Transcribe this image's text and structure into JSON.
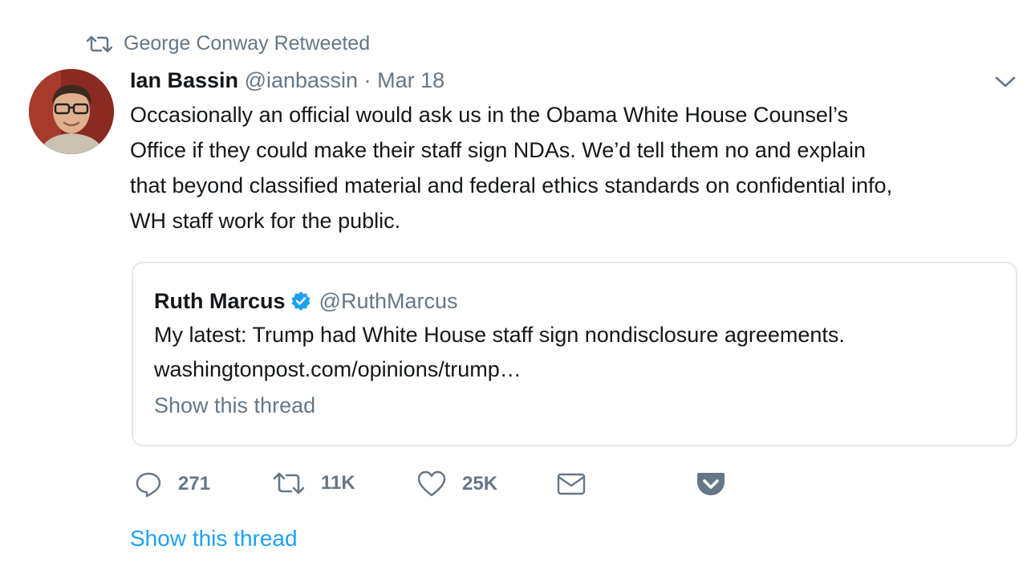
{
  "retweet_context": {
    "text": "George Conway Retweeted"
  },
  "tweet": {
    "author_name": "Ian Bassin",
    "author_handle": "@ianbassin",
    "separator": "·",
    "date": "Mar 18",
    "text_lines": [
      "Occasionally an official would ask us in the Obama White House Counsel’s",
      "Office if they could make their staff sign NDAs. We’d tell them no and explain",
      "that beyond classified material and federal ethics standards on confidential info,",
      "WH staff work for the public."
    ]
  },
  "quoted_tweet": {
    "author_name": "Ruth Marcus",
    "author_handle": "@RuthMarcus",
    "verified": true,
    "text_lines": [
      "My latest: Trump had White House staff sign nondisclosure agreements.",
      "washingtonpost.com/opinions/trump…"
    ],
    "show_thread_label": "Show this thread"
  },
  "actions": {
    "reply": {
      "icon": "reply-icon",
      "count": "271"
    },
    "retweet": {
      "icon": "retweet-icon",
      "count": "11K"
    },
    "like": {
      "icon": "heart-icon",
      "count": "25K"
    },
    "dm": {
      "icon": "envelope-icon"
    },
    "pocket": {
      "icon": "pocket-icon"
    }
  },
  "show_thread_label": "Show this thread",
  "colors": {
    "text": "#14171a",
    "secondary": "#657786",
    "link": "#1da1f2",
    "border": "#e1e8ed",
    "verified": "#1da1f2",
    "pocket": "#657786"
  }
}
